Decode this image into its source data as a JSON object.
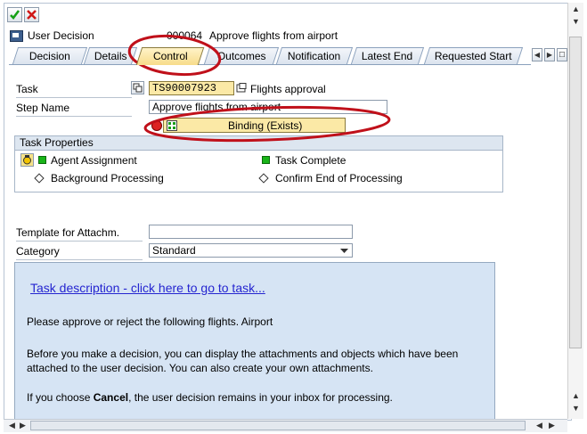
{
  "toolbar": {
    "confirm_icon": "checkmark-icon",
    "cancel_icon": "cancel-x-icon"
  },
  "header": {
    "label": "User Decision",
    "number": "000064",
    "text": "Approve flights from airport"
  },
  "tabs": [
    "Decision",
    "Details",
    "Control",
    "Outcomes",
    "Notification",
    "Latest End",
    "Requested Start"
  ],
  "active_tab": "Control",
  "form": {
    "task_label": "Task",
    "task_value": "TS90007923",
    "task_desc": "Flights approval",
    "step_label": "Step Name",
    "step_value": "Approve flights from airport",
    "binding_label": "Binding (Exists)",
    "template_label": "Template for Attachm.",
    "template_value": "",
    "category_label": "Category",
    "category_value": "Standard"
  },
  "task_properties": {
    "title": "Task Properties",
    "agent": "Agent Assignment",
    "complete": "Task Complete",
    "background": "Background Processing",
    "confirm_end": "Confirm End of Processing"
  },
  "description": {
    "link": "Task description - click here to go to task...",
    "p1": "Please approve or reject the following flights. Airport",
    "p2a": "Before you make a decision, you can display the attachments and objects which have been",
    "p2b": "attached to the user decision. You can also create your own attachments.",
    "p3_pre": "If you choose ",
    "p3_bold": "Cancel",
    "p3_post": ", the user decision remains in your inbox for processing."
  },
  "colors": {
    "annotation": "#c0101a",
    "highlight": "#fbe9a6",
    "group_header": "#dde6f0"
  }
}
